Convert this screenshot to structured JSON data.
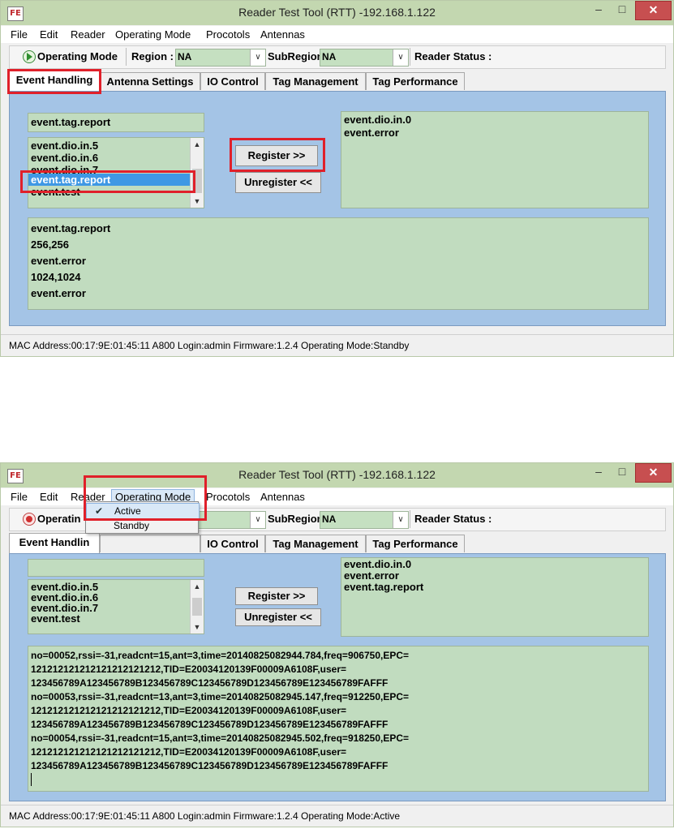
{
  "screen1": {
    "title": "Reader Test Tool (RTT) -192.168.1.122",
    "app_icon": "FE",
    "window_buttons": {
      "minimize": "–",
      "maximize": "□",
      "close": "✕"
    },
    "menu": [
      "File",
      "Edit",
      "Reader",
      "Operating Mode",
      "Procotols",
      "Antennas"
    ],
    "toolbar": {
      "operating_mode_label": "Operating Mode",
      "region_label": "Region :",
      "region_value": "NA",
      "subregion_label": "SubRegion:",
      "subregion_value": "NA",
      "reader_status_label": "Reader Status :"
    },
    "tabs": [
      "Event Handling",
      "Antenna Settings",
      "IO Control",
      "Tag Management",
      "Tag Performance"
    ],
    "event_input": "event.tag.report",
    "event_list": [
      "event.dio.in.5",
      "event.dio.in.6",
      "event.dio.in.7",
      "event.tag.report",
      "event.test"
    ],
    "selected_event": "event.tag.report",
    "register_button": "Register >>",
    "unregister_button": "Unregister <<",
    "registered_events": [
      "event.dio.in.0",
      "event.error"
    ],
    "log_lines": [
      "event.tag.report",
      "256,256",
      "event.error",
      "1024,1024",
      "event.error"
    ],
    "status": "MAC Address:00:17:9E:01:45:11    A800  Login:admin   Firmware:1.2.4   Operating Mode:Standby"
  },
  "screen2": {
    "title": "Reader Test Tool (RTT) -192.168.1.122",
    "app_icon": "FE",
    "window_buttons": {
      "minimize": "–",
      "maximize": "□",
      "close": "✕"
    },
    "menu": [
      "File",
      "Edit",
      "Reader",
      "Operating Mode",
      "Procotols",
      "Antennas"
    ],
    "toolbar": {
      "operating_label": "Operatin",
      "subregion_label": "SubRegion:",
      "subregion_value": "NA",
      "reader_status_label": "Reader Status :"
    },
    "dropdown": {
      "items": [
        "Active",
        "Standby"
      ],
      "checked": "Active"
    },
    "tabs": [
      "Event Handlin",
      "IO Control",
      "Tag Management",
      "Tag Performance"
    ],
    "event_input": "",
    "event_list": [
      "event.dio.in.5",
      "event.dio.in.6",
      "event.dio.in.7",
      "event.test"
    ],
    "register_button": "Register >>",
    "unregister_button": "Unregister <<",
    "registered_events": [
      "event.dio.in.0",
      "event.error",
      "event.tag.report"
    ],
    "log_lines": [
      "no=00052,rssi=-31,readcnt=15,ant=3,time=20140825082944.784,freq=906750,EPC=",
      "121212121212121212121212,TID=E20034120139F00009A6108F,user=",
      "123456789A123456789B123456789C123456789D123456789E123456789FAFFF",
      "no=00053,rssi=-31,readcnt=13,ant=3,time=20140825082945.147,freq=912250,EPC=",
      "121212121212121212121212,TID=E20034120139F00009A6108F,user=",
      "123456789A123456789B123456789C123456789D123456789E123456789FAFFF",
      "no=00054,rssi=-31,readcnt=15,ant=3,time=20140825082945.502,freq=918250,EPC=",
      "121212121212121212121212,TID=E20034120139F00009A6108F,user=",
      "123456789A123456789B123456789C123456789D123456789E123456789FAFFF"
    ],
    "status": "MAC Address:00:17:9E:01:45:11    A800  Login:admin   Firmware:1.2.4   Operating Mode:Active"
  }
}
